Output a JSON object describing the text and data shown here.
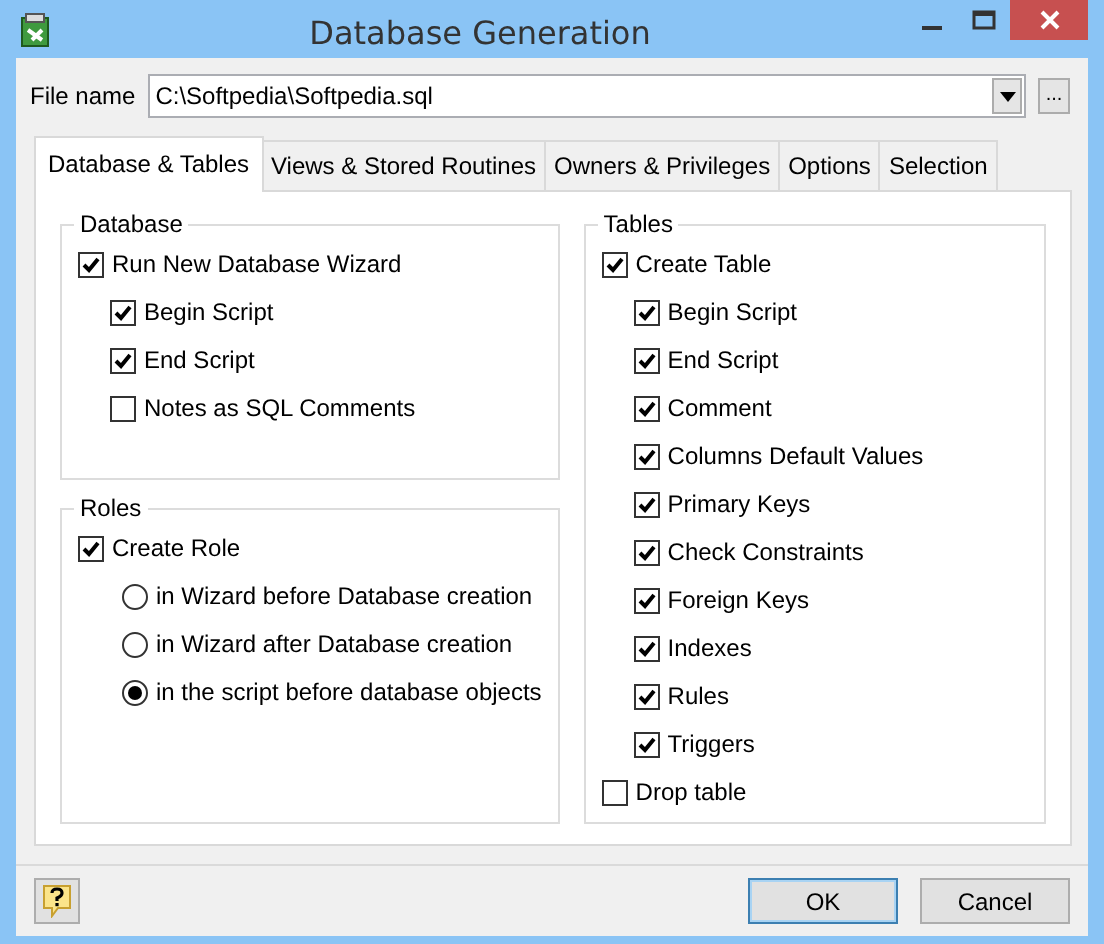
{
  "window": {
    "title": "Database Generation"
  },
  "file_name": {
    "label": "File name",
    "value": "C:\\Softpedia\\Softpedia.sql",
    "browse": "..."
  },
  "tabs": [
    {
      "label": "Database & Tables",
      "selected": true
    },
    {
      "label": "Views & Stored Routines",
      "selected": false
    },
    {
      "label": "Owners & Privileges",
      "selected": false
    },
    {
      "label": "Options",
      "selected": false
    },
    {
      "label": "Selection",
      "selected": false
    }
  ],
  "database_group": {
    "title": "Database",
    "options": [
      {
        "label": "Run New Database Wizard",
        "checked": true,
        "children": [
          {
            "label": "Begin Script",
            "checked": true
          },
          {
            "label": "End Script",
            "checked": true
          },
          {
            "label": "Notes as SQL Comments",
            "checked": false
          }
        ]
      }
    ]
  },
  "roles_group": {
    "title": "Roles",
    "options": [
      {
        "label": "Create Role",
        "checked": true,
        "choices": [
          {
            "label": "in Wizard before Database creation",
            "selected": false
          },
          {
            "label": "in Wizard after Database creation",
            "selected": false
          },
          {
            "label": "in the script before database objects",
            "selected": true
          }
        ]
      }
    ]
  },
  "tables_group": {
    "title": "Tables",
    "options": [
      {
        "label": "Create Table",
        "checked": true,
        "children": [
          {
            "label": "Begin Script",
            "checked": true
          },
          {
            "label": "End Script",
            "checked": true
          },
          {
            "label": "Comment",
            "checked": true
          },
          {
            "label": "Columns Default Values",
            "checked": true
          },
          {
            "label": "Primary Keys",
            "checked": true
          },
          {
            "label": "Check Constraints",
            "checked": true
          },
          {
            "label": "Foreign Keys",
            "checked": true
          },
          {
            "label": "Indexes",
            "checked": true
          },
          {
            "label": "Rules",
            "checked": true
          },
          {
            "label": "Triggers",
            "checked": true
          }
        ]
      },
      {
        "label": "Drop table",
        "checked": false
      }
    ]
  },
  "buttons": [
    {
      "label": "OK",
      "default": true
    },
    {
      "label": "Cancel",
      "default": false
    }
  ]
}
